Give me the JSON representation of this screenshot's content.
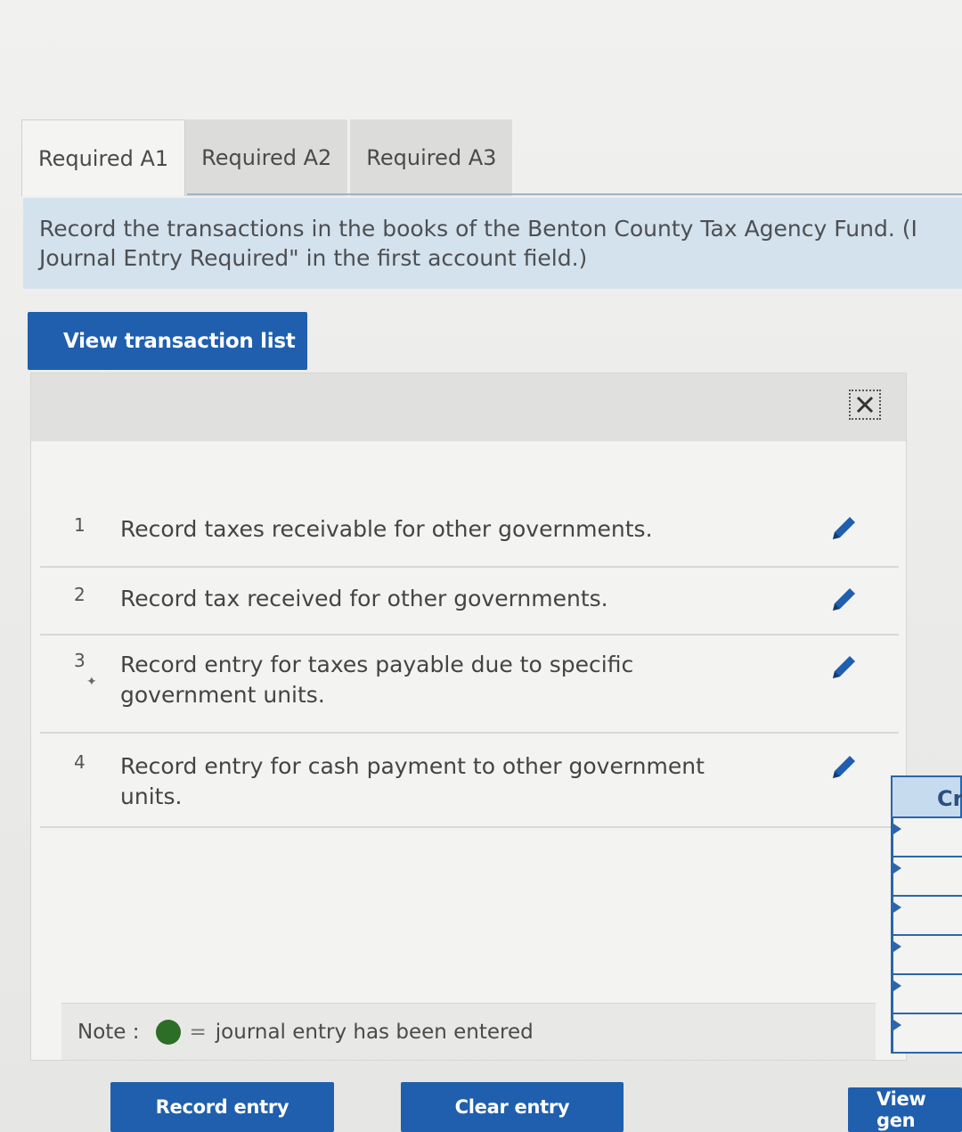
{
  "tabs": [
    "Required A1",
    "Required A2",
    "Required A3"
  ],
  "instruction": {
    "line1": "Record the transactions in the books of the Benton County Tax Agency Fund. (I",
    "line2": "Journal Entry Required\" in the first account field.)"
  },
  "view_list_button": "View transaction list",
  "transactions": [
    {
      "num": "1",
      "lines": [
        "Record taxes receivable for other governments."
      ]
    },
    {
      "num": "2",
      "lines": [
        "Record tax received for other governments."
      ]
    },
    {
      "num": "3",
      "lines": [
        "Record entry for taxes payable due to specific",
        "government units."
      ]
    },
    {
      "num": "4",
      "lines": [
        "Record entry for cash payment to other government",
        "units."
      ]
    }
  ],
  "note": {
    "label": "Note :",
    "equals": "=",
    "text": "journal entry has been entered"
  },
  "grid_header": "Cr",
  "buttons": {
    "record": "Record entry",
    "clear": "Clear entry",
    "view_general": "View gen"
  },
  "colors": {
    "button": "#1f5fae",
    "instruction_bg": "#d4e2ee",
    "entered_dot": "#2c6d27"
  }
}
